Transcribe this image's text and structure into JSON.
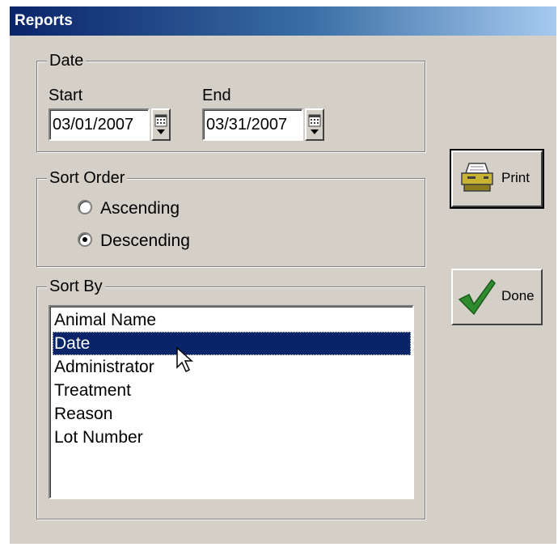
{
  "window": {
    "title": "Reports"
  },
  "date_group": {
    "legend": "Date",
    "start_label": "Start",
    "start_value": "03/01/2007",
    "end_label": "End",
    "end_value": "03/31/2007"
  },
  "sort_order": {
    "legend": "Sort Order",
    "options": [
      {
        "label": "Ascending",
        "selected": false
      },
      {
        "label": "Descending",
        "selected": true
      }
    ]
  },
  "sort_by": {
    "legend": "Sort By",
    "items": [
      "Animal Name",
      "Date",
      "Administrator",
      "Treatment",
      "Reason",
      "Lot Number"
    ],
    "selected": "Date"
  },
  "buttons": {
    "print_label": "Print",
    "done_label": "Done"
  },
  "icons": {
    "print": "printer-icon",
    "done": "checkmark-icon",
    "calendar": "calendar-icon"
  },
  "colors": {
    "selection": "#0a246a",
    "window_bg": "#d4d0c8",
    "checkmark": "#2e8b2e"
  }
}
